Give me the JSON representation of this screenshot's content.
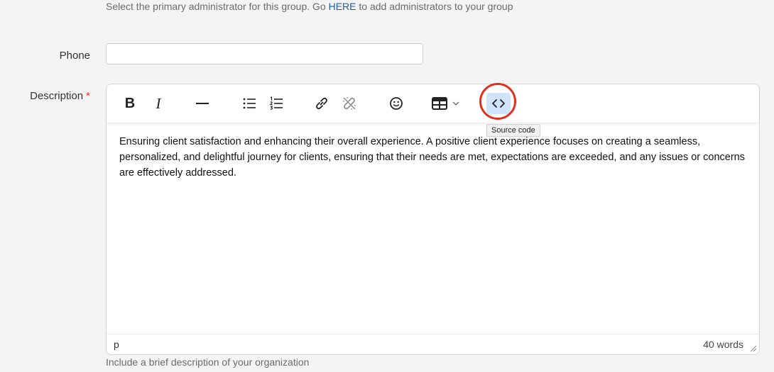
{
  "admin_hint": {
    "before": "Select the primary administrator for this group. Go ",
    "link": "HERE",
    "after": " to add administrators to your group"
  },
  "phone": {
    "label": "Phone",
    "value": "",
    "placeholder": ""
  },
  "description": {
    "label": "Description",
    "required_mark": "*",
    "toolbar": {
      "bold_label": "B",
      "italic_label": "I",
      "icons": [
        "horizontal-line-icon",
        "bullet-list-icon",
        "numbered-list-icon",
        "link-icon",
        "unlink-icon",
        "emoji-icon",
        "table-icon",
        "chevron-down-icon",
        "source-code-icon"
      ]
    },
    "tooltip": "Source code",
    "content": "Ensuring client satisfaction and enhancing their overall experience. A positive client experience focuses on creating a seamless, personalized, and delightful journey for clients, ensuring that their needs are met, expectations are exceeded, and any issues or concerns are effectively addressed.",
    "status_path": "p",
    "word_count": "40 words",
    "hint": "Include a brief description of your organization"
  },
  "colors": {
    "link": "#1f5fa6",
    "required": "#d63b2f",
    "highlight_ring": "#e0311f",
    "active_button": "#cfe3fb"
  }
}
